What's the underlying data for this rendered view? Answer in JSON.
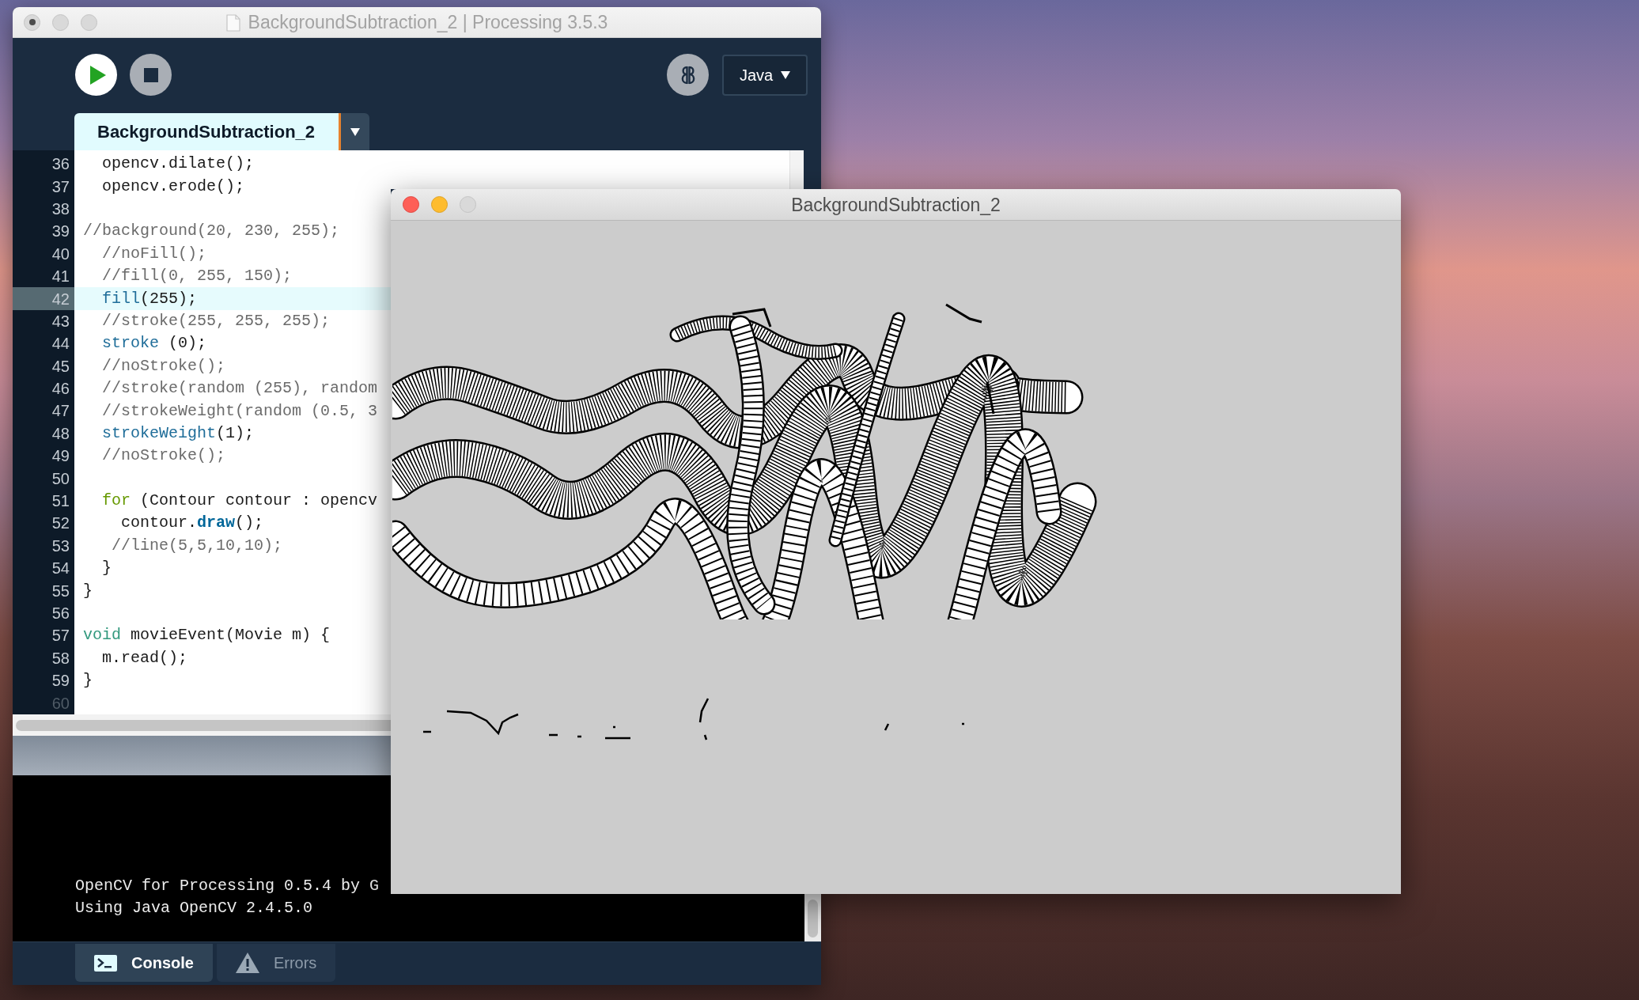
{
  "editor_window": {
    "title": "BackgroundSubtraction_2 | Processing 3.5.3",
    "focused": false,
    "unsaved": true,
    "mode": "Java",
    "tabs": [
      {
        "label": "BackgroundSubtraction_2",
        "selected": true
      }
    ],
    "code_lines": [
      {
        "number": "36",
        "tokens": [
          {
            "kind": "plain",
            "text": "  opencv.dilate();"
          }
        ],
        "current": false,
        "dimmed": false
      },
      {
        "number": "37",
        "tokens": [
          {
            "kind": "plain",
            "text": "  opencv.erode();"
          }
        ],
        "current": false,
        "dimmed": false
      },
      {
        "number": "38",
        "current": false,
        "dimmed": false
      },
      {
        "number": "39",
        "tokens": [
          {
            "kind": "comment",
            "text": "//background(20, 230, 255);"
          }
        ],
        "current": false,
        "dimmed": false
      },
      {
        "number": "40",
        "tokens": [
          {
            "kind": "comment",
            "text": "  //noFill();"
          }
        ],
        "current": false,
        "dimmed": false
      },
      {
        "number": "41",
        "tokens": [
          {
            "kind": "comment",
            "text": "  //fill(0, 255, 150);"
          }
        ],
        "current": false,
        "dimmed": false
      },
      {
        "number": "42",
        "tokens": [
          {
            "kind": "function",
            "text": "  fill"
          },
          {
            "kind": "plain",
            "text": "(255);"
          }
        ],
        "current": true,
        "dimmed": false
      },
      {
        "number": "43",
        "tokens": [
          {
            "kind": "comment",
            "text": "  //stroke(255, 255, 255);"
          }
        ],
        "current": false,
        "dimmed": false
      },
      {
        "number": "44",
        "tokens": [
          {
            "kind": "function",
            "text": "  stroke"
          },
          {
            "kind": "plain",
            "text": " (0);"
          }
        ],
        "current": false,
        "dimmed": false
      },
      {
        "number": "45",
        "tokens": [
          {
            "kind": "comment",
            "text": "  //noStroke();"
          }
        ],
        "current": false,
        "dimmed": false
      },
      {
        "number": "46",
        "tokens": [
          {
            "kind": "comment",
            "text": "  //stroke(random (255), random"
          }
        ],
        "current": false,
        "dimmed": false
      },
      {
        "number": "47",
        "tokens": [
          {
            "kind": "comment",
            "text": "  //strokeWeight(random (0.5, 3"
          }
        ],
        "current": false,
        "dimmed": false
      },
      {
        "number": "48",
        "tokens": [
          {
            "kind": "function",
            "text": "  strokeWeight"
          },
          {
            "kind": "plain",
            "text": "(1);"
          }
        ],
        "current": false,
        "dimmed": false
      },
      {
        "number": "49",
        "tokens": [
          {
            "kind": "comment",
            "text": "  //noStroke();"
          }
        ],
        "current": false,
        "dimmed": false
      },
      {
        "number": "50",
        "current": false,
        "dimmed": false
      },
      {
        "number": "51",
        "tokens": [
          {
            "kind": "keyword",
            "text": "  for"
          },
          {
            "kind": "plain",
            "text": " (Contour contour : opencv"
          }
        ],
        "current": false,
        "dimmed": false
      },
      {
        "number": "52",
        "tokens": [
          {
            "kind": "plain",
            "text": "    contour."
          },
          {
            "kind": "method",
            "text": "draw"
          },
          {
            "kind": "plain",
            "text": "();"
          }
        ],
        "current": false,
        "dimmed": false
      },
      {
        "number": "53",
        "tokens": [
          {
            "kind": "comment",
            "text": "   //line(5,5,10,10);"
          }
        ],
        "current": false,
        "dimmed": false
      },
      {
        "number": "54",
        "tokens": [
          {
            "kind": "plain",
            "text": "  }"
          }
        ],
        "current": false,
        "dimmed": false
      },
      {
        "number": "55",
        "tokens": [
          {
            "kind": "plain",
            "text": "}"
          }
        ],
        "current": false,
        "dimmed": false
      },
      {
        "number": "56",
        "current": false,
        "dimmed": false
      },
      {
        "number": "57",
        "tokens": [
          {
            "kind": "type",
            "text": "void"
          },
          {
            "kind": "plain",
            "text": " movieEvent(Movie m) {"
          }
        ],
        "current": false,
        "dimmed": false
      },
      {
        "number": "58",
        "tokens": [
          {
            "kind": "plain",
            "text": "  m.read();"
          }
        ],
        "current": false,
        "dimmed": false
      },
      {
        "number": "59",
        "tokens": [
          {
            "kind": "plain",
            "text": "}"
          }
        ],
        "current": false,
        "dimmed": false
      },
      {
        "number": "60",
        "current": false,
        "dimmed": true
      }
    ],
    "console_lines": [
      "OpenCV for Processing 0.5.4 by G",
      "Using Java OpenCV 2.4.5.0"
    ],
    "bottom_tabs": [
      {
        "kind": "console",
        "label": "Console",
        "selected": true
      },
      {
        "kind": "errors",
        "label": "Errors",
        "selected": false
      }
    ]
  },
  "sketch_window": {
    "title": "BackgroundSubtraction_2",
    "focused": true
  }
}
